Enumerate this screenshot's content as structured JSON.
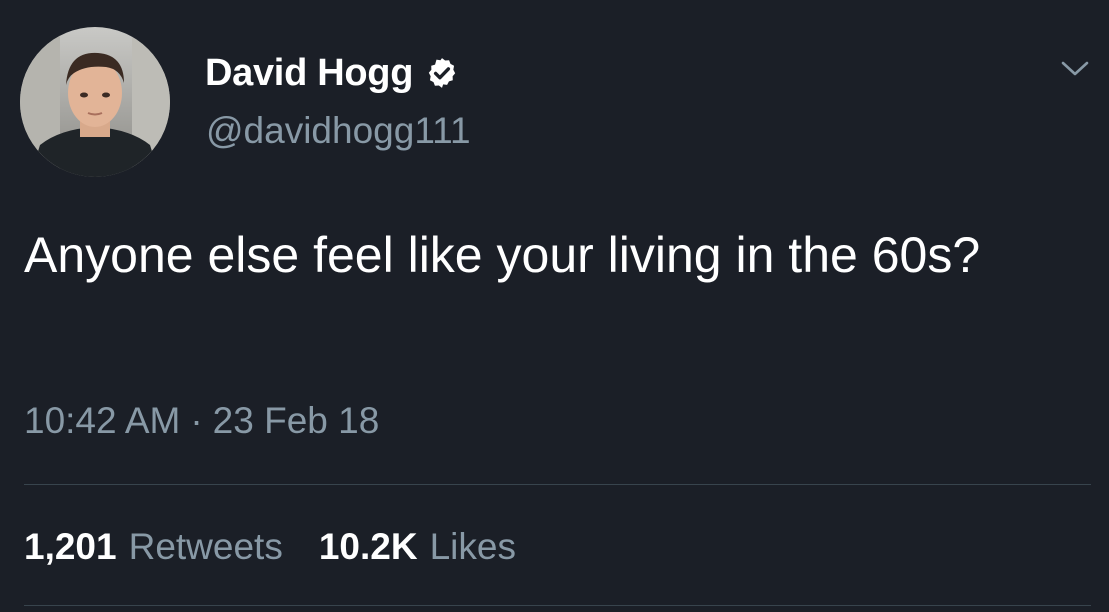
{
  "tweet": {
    "author": {
      "display_name": "David Hogg",
      "handle": "@davidhogg111",
      "verified": true,
      "avatar_icon": "profile-photo"
    },
    "text": "Anyone else feel like your living in the 60s?",
    "time": "10:42 AM",
    "separator": "·",
    "date": "23 Feb 18",
    "stats": {
      "retweets_count": "1,201",
      "retweets_label": "Retweets",
      "likes_count": "10.2K",
      "likes_label": "Likes"
    },
    "menu_icon": "chevron-down-icon"
  },
  "colors": {
    "background": "#1b1f27",
    "primary_text": "#ffffff",
    "secondary_text": "#8899a6",
    "divider": "#38444d",
    "verified_badge": "#ffffff"
  }
}
